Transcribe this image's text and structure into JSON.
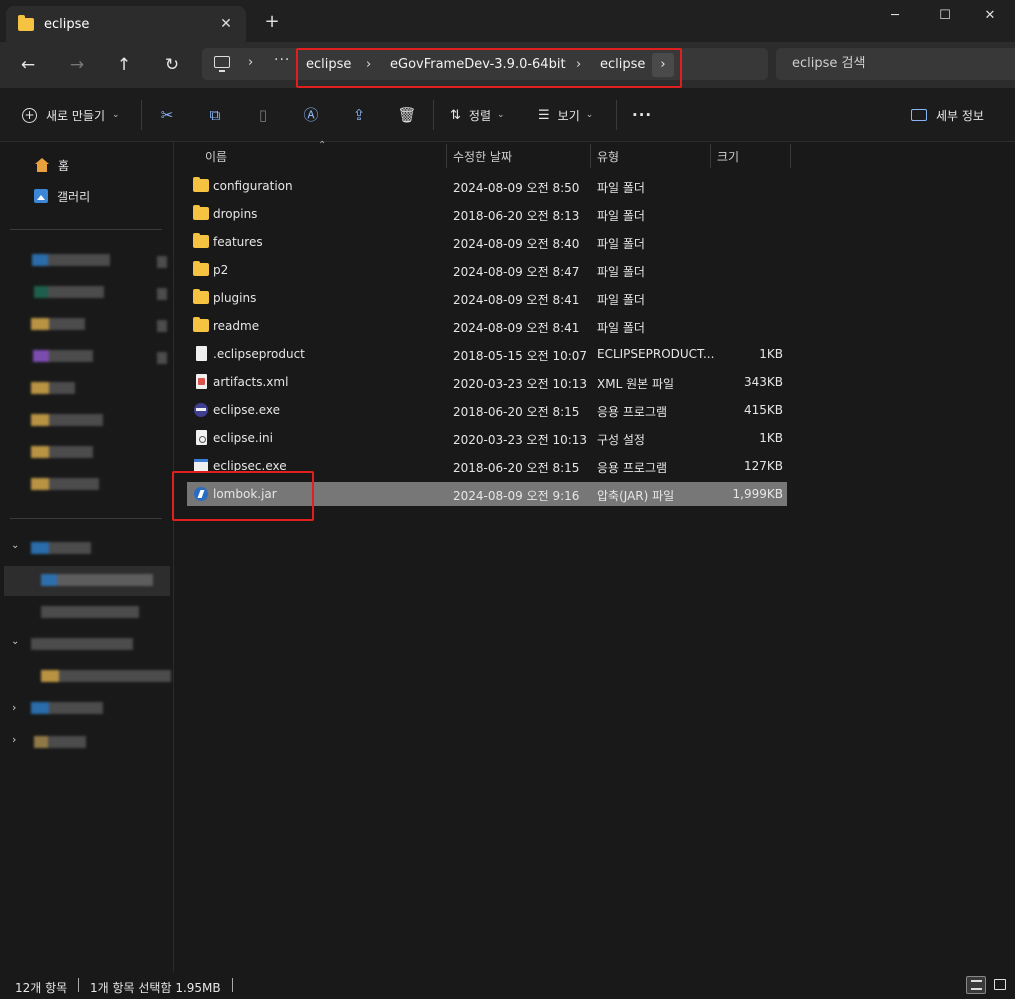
{
  "window": {
    "tab_title": "eclipse",
    "tab_close": "✕",
    "new_tab": "+",
    "minimize": "─",
    "maximize": "☐",
    "close": "✕"
  },
  "address": {
    "more": "···",
    "breadcrumbs": [
      "eclipse",
      "eGovFrameDev-3.9.0-64bit",
      "eclipse"
    ],
    "chevron": "›",
    "search_placeholder": "eclipse 검색"
  },
  "toolbar": {
    "new_label": "새로 만들기",
    "sort_label": "정렬",
    "view_label": "보기",
    "more": "···",
    "details_label": "세부 정보"
  },
  "sidebar": {
    "home_label": "홈",
    "gallery_label": "갤러리"
  },
  "columns": {
    "name": "이름",
    "date": "수정한 날짜",
    "type": "유형",
    "size": "크기"
  },
  "files": [
    {
      "name": "configuration",
      "date": "2024-08-09 오전 8:50",
      "type": "파일 폴더",
      "size": "",
      "icon": "folder-icon"
    },
    {
      "name": "dropins",
      "date": "2018-06-20 오전 8:13",
      "type": "파일 폴더",
      "size": "",
      "icon": "folder-icon"
    },
    {
      "name": "features",
      "date": "2024-08-09 오전 8:40",
      "type": "파일 폴더",
      "size": "",
      "icon": "folder-icon"
    },
    {
      "name": "p2",
      "date": "2024-08-09 오전 8:47",
      "type": "파일 폴더",
      "size": "",
      "icon": "folder-icon"
    },
    {
      "name": "plugins",
      "date": "2024-08-09 오전 8:41",
      "type": "파일 폴더",
      "size": "",
      "icon": "folder-icon"
    },
    {
      "name": "readme",
      "date": "2024-08-09 오전 8:41",
      "type": "파일 폴더",
      "size": "",
      "icon": "folder-icon"
    },
    {
      "name": ".eclipseproduct",
      "date": "2018-05-15 오전 10:07",
      "type": "ECLIPSEPRODUCT...",
      "size": "1KB",
      "icon": "file-icon"
    },
    {
      "name": "artifacts.xml",
      "date": "2020-03-23 오전 10:13",
      "type": "XML 원본 파일",
      "size": "343KB",
      "icon": "xml-file-icon"
    },
    {
      "name": "eclipse.exe",
      "date": "2018-06-20 오전 8:15",
      "type": "응용 프로그램",
      "size": "415KB",
      "icon": "eclipse-app-icon"
    },
    {
      "name": "eclipse.ini",
      "date": "2020-03-23 오전 10:13",
      "type": "구성 설정",
      "size": "1KB",
      "icon": "settings-file-icon"
    },
    {
      "name": "eclipsec.exe",
      "date": "2018-06-20 오전 8:15",
      "type": "응용 프로그램",
      "size": "127KB",
      "icon": "console-app-icon"
    },
    {
      "name": "lombok.jar",
      "date": "2024-08-09 오전 9:16",
      "type": "압축(JAR) 파일",
      "size": "1,999KB",
      "icon": "jar-file-icon",
      "selected": true
    }
  ],
  "status": {
    "item_count": "12개 항목",
    "selection": "1개 항목 선택함 1.95MB"
  },
  "colors": {
    "highlight_box": "#e0201e",
    "folder": "#f5c242",
    "selection": "#777777",
    "accent_icon": "#8ab4f8"
  }
}
